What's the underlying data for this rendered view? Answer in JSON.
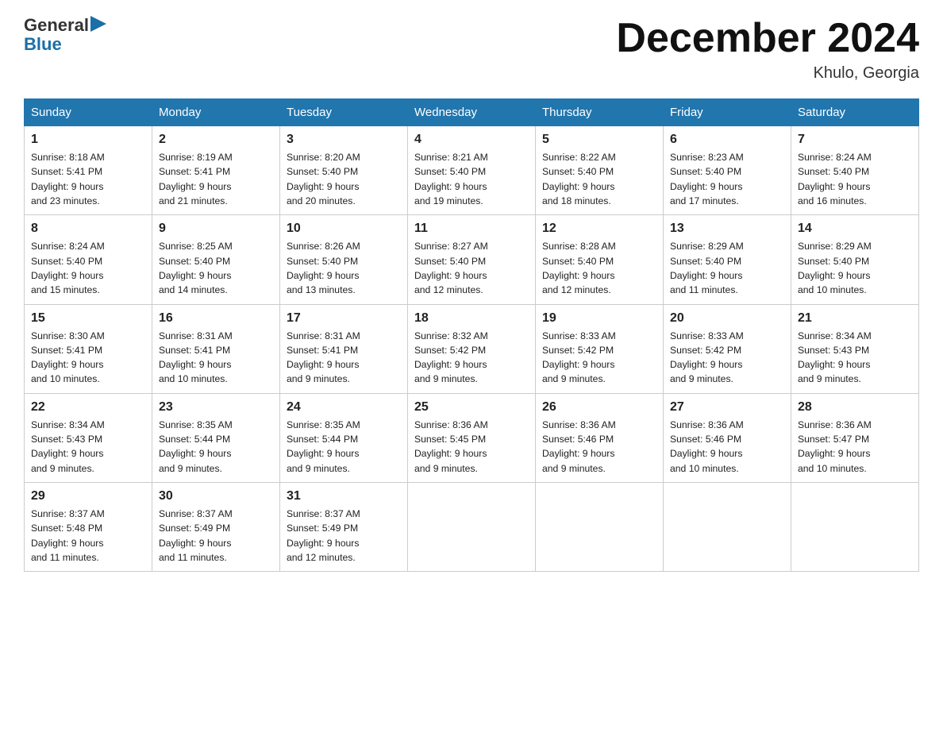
{
  "header": {
    "logo_general": "General",
    "logo_blue": "Blue",
    "title": "December 2024",
    "location": "Khulo, Georgia"
  },
  "days_of_week": [
    "Sunday",
    "Monday",
    "Tuesday",
    "Wednesday",
    "Thursday",
    "Friday",
    "Saturday"
  ],
  "weeks": [
    [
      {
        "day": "1",
        "info": "Sunrise: 8:18 AM\nSunset: 5:41 PM\nDaylight: 9 hours\nand 23 minutes."
      },
      {
        "day": "2",
        "info": "Sunrise: 8:19 AM\nSunset: 5:41 PM\nDaylight: 9 hours\nand 21 minutes."
      },
      {
        "day": "3",
        "info": "Sunrise: 8:20 AM\nSunset: 5:40 PM\nDaylight: 9 hours\nand 20 minutes."
      },
      {
        "day": "4",
        "info": "Sunrise: 8:21 AM\nSunset: 5:40 PM\nDaylight: 9 hours\nand 19 minutes."
      },
      {
        "day": "5",
        "info": "Sunrise: 8:22 AM\nSunset: 5:40 PM\nDaylight: 9 hours\nand 18 minutes."
      },
      {
        "day": "6",
        "info": "Sunrise: 8:23 AM\nSunset: 5:40 PM\nDaylight: 9 hours\nand 17 minutes."
      },
      {
        "day": "7",
        "info": "Sunrise: 8:24 AM\nSunset: 5:40 PM\nDaylight: 9 hours\nand 16 minutes."
      }
    ],
    [
      {
        "day": "8",
        "info": "Sunrise: 8:24 AM\nSunset: 5:40 PM\nDaylight: 9 hours\nand 15 minutes."
      },
      {
        "day": "9",
        "info": "Sunrise: 8:25 AM\nSunset: 5:40 PM\nDaylight: 9 hours\nand 14 minutes."
      },
      {
        "day": "10",
        "info": "Sunrise: 8:26 AM\nSunset: 5:40 PM\nDaylight: 9 hours\nand 13 minutes."
      },
      {
        "day": "11",
        "info": "Sunrise: 8:27 AM\nSunset: 5:40 PM\nDaylight: 9 hours\nand 12 minutes."
      },
      {
        "day": "12",
        "info": "Sunrise: 8:28 AM\nSunset: 5:40 PM\nDaylight: 9 hours\nand 12 minutes."
      },
      {
        "day": "13",
        "info": "Sunrise: 8:29 AM\nSunset: 5:40 PM\nDaylight: 9 hours\nand 11 minutes."
      },
      {
        "day": "14",
        "info": "Sunrise: 8:29 AM\nSunset: 5:40 PM\nDaylight: 9 hours\nand 10 minutes."
      }
    ],
    [
      {
        "day": "15",
        "info": "Sunrise: 8:30 AM\nSunset: 5:41 PM\nDaylight: 9 hours\nand 10 minutes."
      },
      {
        "day": "16",
        "info": "Sunrise: 8:31 AM\nSunset: 5:41 PM\nDaylight: 9 hours\nand 10 minutes."
      },
      {
        "day": "17",
        "info": "Sunrise: 8:31 AM\nSunset: 5:41 PM\nDaylight: 9 hours\nand 9 minutes."
      },
      {
        "day": "18",
        "info": "Sunrise: 8:32 AM\nSunset: 5:42 PM\nDaylight: 9 hours\nand 9 minutes."
      },
      {
        "day": "19",
        "info": "Sunrise: 8:33 AM\nSunset: 5:42 PM\nDaylight: 9 hours\nand 9 minutes."
      },
      {
        "day": "20",
        "info": "Sunrise: 8:33 AM\nSunset: 5:42 PM\nDaylight: 9 hours\nand 9 minutes."
      },
      {
        "day": "21",
        "info": "Sunrise: 8:34 AM\nSunset: 5:43 PM\nDaylight: 9 hours\nand 9 minutes."
      }
    ],
    [
      {
        "day": "22",
        "info": "Sunrise: 8:34 AM\nSunset: 5:43 PM\nDaylight: 9 hours\nand 9 minutes."
      },
      {
        "day": "23",
        "info": "Sunrise: 8:35 AM\nSunset: 5:44 PM\nDaylight: 9 hours\nand 9 minutes."
      },
      {
        "day": "24",
        "info": "Sunrise: 8:35 AM\nSunset: 5:44 PM\nDaylight: 9 hours\nand 9 minutes."
      },
      {
        "day": "25",
        "info": "Sunrise: 8:36 AM\nSunset: 5:45 PM\nDaylight: 9 hours\nand 9 minutes."
      },
      {
        "day": "26",
        "info": "Sunrise: 8:36 AM\nSunset: 5:46 PM\nDaylight: 9 hours\nand 9 minutes."
      },
      {
        "day": "27",
        "info": "Sunrise: 8:36 AM\nSunset: 5:46 PM\nDaylight: 9 hours\nand 10 minutes."
      },
      {
        "day": "28",
        "info": "Sunrise: 8:36 AM\nSunset: 5:47 PM\nDaylight: 9 hours\nand 10 minutes."
      }
    ],
    [
      {
        "day": "29",
        "info": "Sunrise: 8:37 AM\nSunset: 5:48 PM\nDaylight: 9 hours\nand 11 minutes."
      },
      {
        "day": "30",
        "info": "Sunrise: 8:37 AM\nSunset: 5:49 PM\nDaylight: 9 hours\nand 11 minutes."
      },
      {
        "day": "31",
        "info": "Sunrise: 8:37 AM\nSunset: 5:49 PM\nDaylight: 9 hours\nand 12 minutes."
      },
      {
        "day": "",
        "info": ""
      },
      {
        "day": "",
        "info": ""
      },
      {
        "day": "",
        "info": ""
      },
      {
        "day": "",
        "info": ""
      }
    ]
  ]
}
